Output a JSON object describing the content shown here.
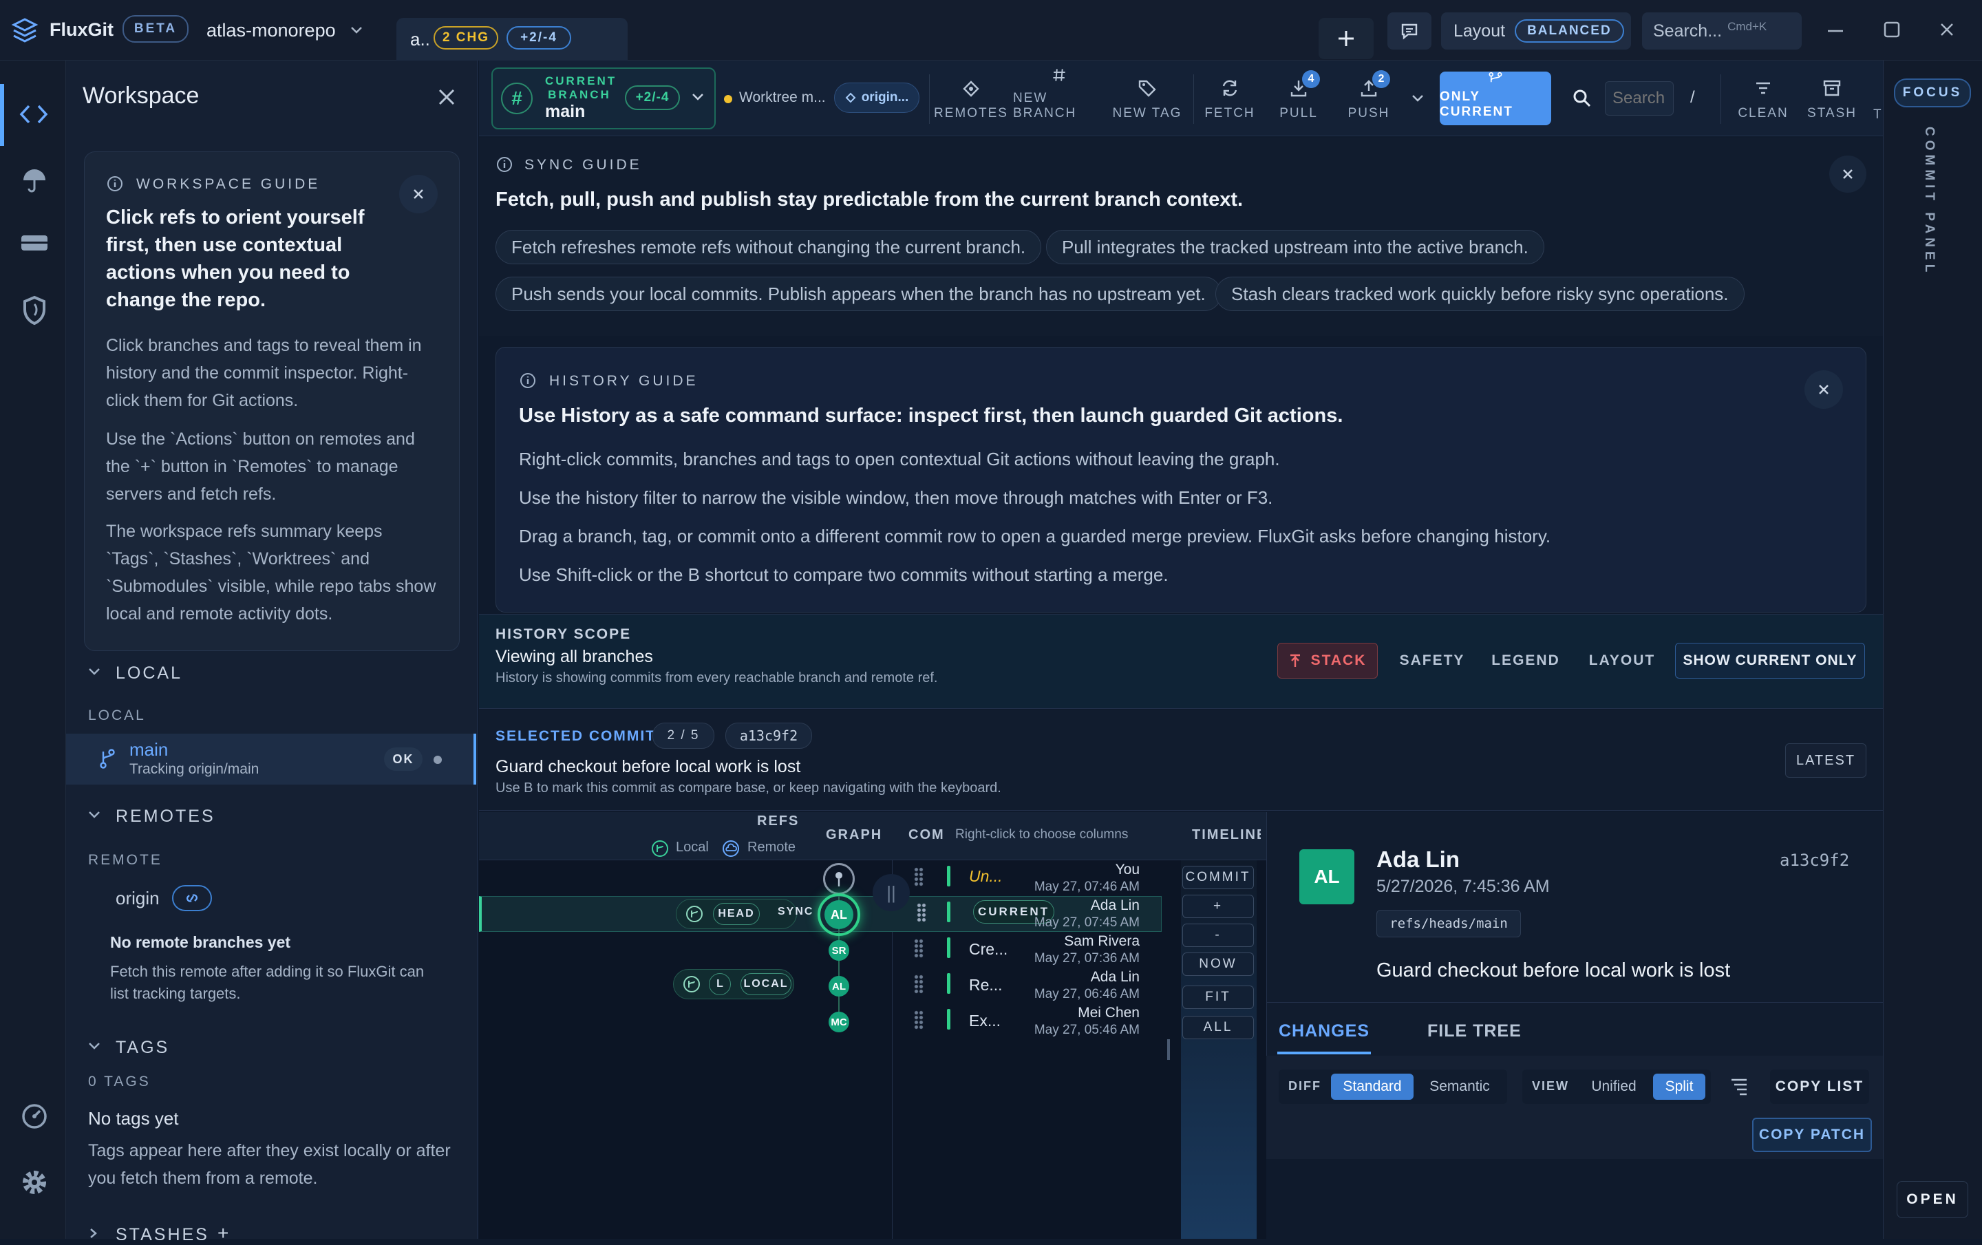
{
  "app": {
    "name": "FluxGit",
    "beta": "BETA",
    "repo": "atlas-monorepo",
    "tab_label": "a..",
    "tab_changes": "2 CHG",
    "tab_diff": "+2/-4"
  },
  "titlebar": {
    "layout_label": "Layout",
    "layout_value": "BALANCED",
    "search": "Search...",
    "search_shortcut": "Cmd+K"
  },
  "sidebar": {
    "title": "Workspace",
    "guide": {
      "label": "WORKSPACE GUIDE",
      "heading": "Click refs to orient yourself first, then use contextual actions when you need to change the repo.",
      "p1": "Click branches and tags to reveal them in history and the commit inspector. Right-click them for Git actions.",
      "p2": "Use the `Actions` button on remotes and the `+` button in `Remotes` to manage servers and fetch refs.",
      "p3": "The workspace refs summary keeps `Tags`, `Stashes`, `Worktrees` and `Submodules` visible, while repo tabs show local and remote activity dots."
    },
    "local": {
      "section": "LOCAL",
      "sub": "LOCAL",
      "branch": "main",
      "tracking": "Tracking origin/main",
      "status": "OK"
    },
    "remotes": {
      "section": "REMOTES",
      "sub": "REMOTE",
      "name": "origin",
      "empty_title": "No remote branches yet",
      "empty_text": "Fetch this remote after adding it so FluxGit can list tracking targets."
    },
    "tags": {
      "section": "TAGS",
      "count": "0 TAGS",
      "empty_title": "No tags yet",
      "empty_text": "Tags appear here after they exist locally or after you fetch them from a remote."
    },
    "stashes": {
      "section": "STASHES",
      "add": "+"
    }
  },
  "toolbar": {
    "current_branch_label": "CURRENT BRANCH",
    "branch": "main",
    "diff": "+2/-4",
    "worktree": "Worktree m...",
    "origin": "origin...",
    "remotes": "REMOTES",
    "new_branch": "NEW BRANCH",
    "new_tag": "NEW TAG",
    "fetch": "FETCH",
    "pull": "PULL",
    "pull_count": "4",
    "push": "PUSH",
    "push_count": "2",
    "only_current": "ONLY CURRENT",
    "search_placeholder": "Search",
    "slash": "/",
    "clean": "CLEAN",
    "stash": "STASH",
    "more": "T",
    "focus": "FOCUS"
  },
  "sync_guide": {
    "label": "SYNC GUIDE",
    "heading": "Fetch, pull, push and publish stay predictable from the current branch context.",
    "chips": [
      "Fetch refreshes remote refs without changing the current branch.",
      "Pull integrates the tracked upstream into the active branch.",
      "Push sends your local commits. Publish appears when the branch has no upstream yet.",
      "Stash clears tracked work quickly before risky sync operations."
    ]
  },
  "history_guide": {
    "label": "HISTORY GUIDE",
    "heading": "Use History as a safe command surface: inspect first, then launch guarded Git actions.",
    "lines": [
      "Right-click commits, branches and tags to open contextual Git actions without leaving the graph.",
      "Use the history filter to narrow the visible window, then move through matches with Enter or F3.",
      "Drag a branch, tag, or commit onto a different commit row to open a guarded merge preview. FluxGit asks before changing history.",
      "Use Shift-click or the B shortcut to compare two commits without starting a merge."
    ]
  },
  "scope": {
    "label": "HISTORY SCOPE",
    "title": "Viewing all branches",
    "text": "History is showing commits from every reachable branch and remote ref.",
    "stack": "STACK",
    "safety": "SAFETY",
    "legend": "LEGEND",
    "layout": "LAYOUT",
    "show_current": "SHOW CURRENT ONLY"
  },
  "selected": {
    "label": "SELECTED COMMIT",
    "pos": "2 / 5",
    "hash": "a13c9f2",
    "title": "Guard checkout before local work is lost",
    "text": "Use B to mark this commit as compare base, or keep navigating with the keyboard.",
    "latest": "LATEST"
  },
  "graph": {
    "refs": "REFS",
    "local": "Local",
    "remote": "Remote",
    "graph": "GRAPH",
    "commit_col": "COM",
    "col_hint": "Right-click to choose columns",
    "timeline": "TIMELINE",
    "head": "HEAD",
    "sync": "SYNC",
    "l_tag": "L",
    "local_tag": "LOCAL",
    "current": "CURRENT",
    "commits": [
      {
        "msg": "Un...",
        "author": "You",
        "date": "May 27, 07:46 AM",
        "initials": ""
      },
      {
        "msg": "",
        "author": "Ada Lin",
        "date": "May 27, 07:45 AM",
        "initials": "AL"
      },
      {
        "msg": "Cre...",
        "author": "Sam Rivera",
        "date": "May 27, 07:36 AM",
        "initials": "SR"
      },
      {
        "msg": "Re...",
        "author": "Ada Lin",
        "date": "May 27, 06:46 AM",
        "initials": "AL"
      },
      {
        "msg": "Ex...",
        "author": "Mei Chen",
        "date": "May 27, 05:46 AM",
        "initials": "MC"
      }
    ],
    "timeline_controls": [
      "COMMIT",
      "+",
      "-",
      "NOW",
      "FIT",
      "ALL"
    ]
  },
  "inspector": {
    "initials": "AL",
    "author": "Ada Lin",
    "date": "5/27/2026, 7:45:36 AM",
    "hash": "a13c9f2",
    "ref": "refs/heads/main",
    "message": "Guard checkout before local work is lost",
    "tab_changes": "CHANGES",
    "tab_tree": "FILE TREE",
    "diff_label": "DIFF",
    "standard": "Standard",
    "semantic": "Semantic",
    "view_label": "VIEW",
    "unified": "Unified",
    "split": "Split",
    "copy_list": "COPY LIST",
    "copy_patch": "COPY PATCH"
  },
  "right_rail": {
    "commit_panel": "COMMIT PANEL",
    "open": "OPEN"
  },
  "colors": {
    "accent": "#5aa8ff",
    "ok": "#22c08a",
    "warn": "#f2c12e",
    "danger": "#e0585a"
  }
}
